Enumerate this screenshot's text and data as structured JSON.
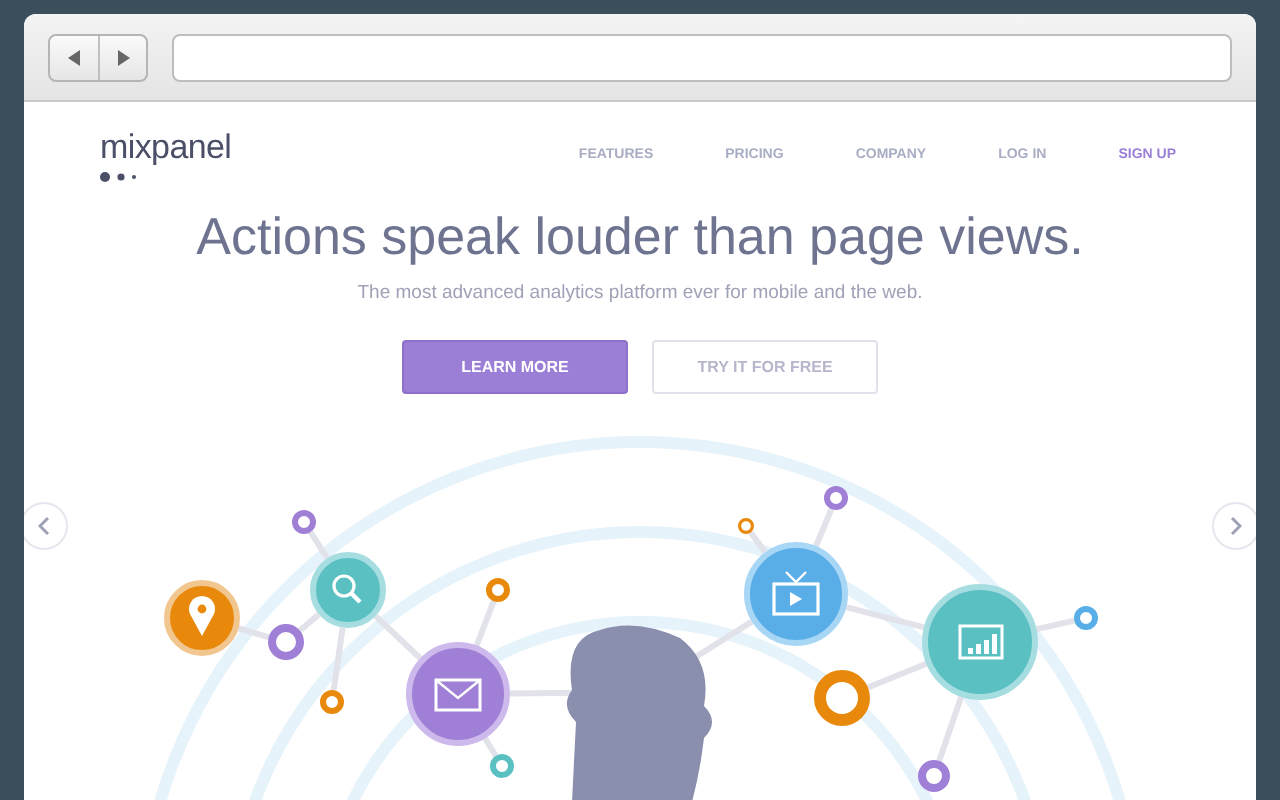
{
  "nav": {
    "logo": "mixpanel",
    "links": [
      {
        "label": "FEATURES",
        "highlighted": false
      },
      {
        "label": "PRICING",
        "highlighted": false
      },
      {
        "label": "COMPANY",
        "highlighted": false
      },
      {
        "label": "LOG IN",
        "highlighted": false
      },
      {
        "label": "SIGN UP",
        "highlighted": true
      }
    ]
  },
  "hero": {
    "headline": "Actions speak louder than page views.",
    "subtitle": "The most advanced analytics platform ever for mobile and the web.",
    "buttons": [
      {
        "label": "LEARN MORE",
        "kind": "primary"
      },
      {
        "label": "TRY IT FOR FREE",
        "kind": "outline"
      }
    ]
  }
}
